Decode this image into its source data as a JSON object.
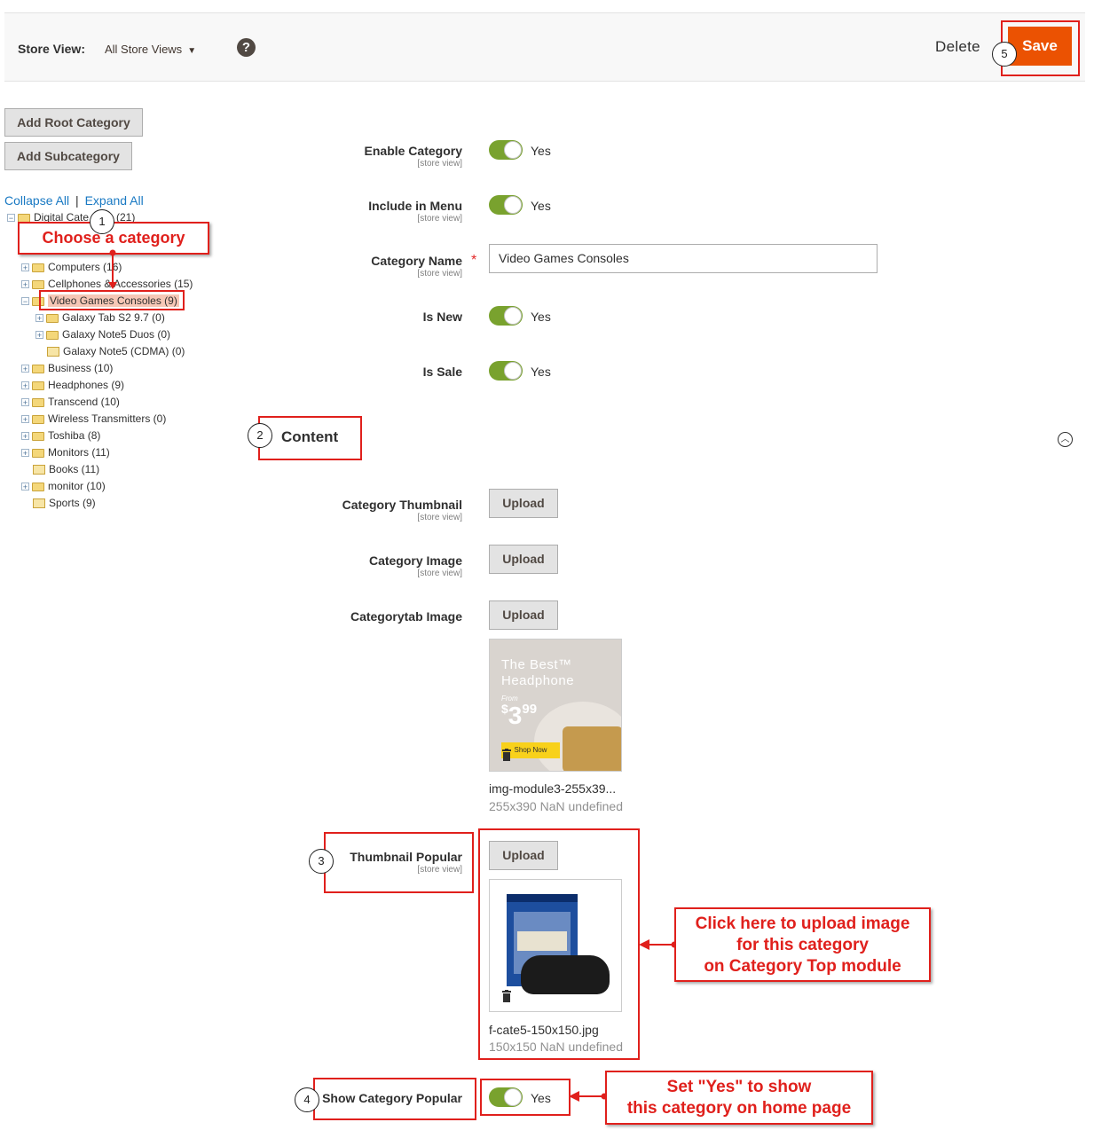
{
  "header": {
    "store_view_label": "Store View:",
    "store_view_value": "All Store Views",
    "help_glyph": "?",
    "delete_label": "Delete",
    "save_label": "Save"
  },
  "sidebar": {
    "add_root_label": "Add Root Category",
    "add_sub_label": "Add Subcategory",
    "collapse_all": "Collapse All",
    "separator": "|",
    "expand_all": "Expand All",
    "root": "Digital Cate",
    "root_count": "(21)",
    "tree": [
      {
        "label": "Computers (16)",
        "kind": "plus-folder"
      },
      {
        "label": "Cellphones & Accessories (15)",
        "kind": "plus-folder"
      },
      {
        "label": "Video Games Consoles (9)",
        "kind": "minus-folder"
      },
      {
        "label": "Galaxy Tab S2 9.7 (0)",
        "kind": "plus-folder"
      },
      {
        "label": "Galaxy Note5 Duos (0)",
        "kind": "plus-folder"
      },
      {
        "label": "Galaxy Note5 (CDMA) (0)",
        "kind": "leaf"
      },
      {
        "label": "Business (10)",
        "kind": "plus-folder"
      },
      {
        "label": "Headphones (9)",
        "kind": "plus-folder"
      },
      {
        "label": "Transcend (10)",
        "kind": "plus-folder"
      },
      {
        "label": "Wireless Transmitters (0)",
        "kind": "plus-folder"
      },
      {
        "label": "Toshiba (8)",
        "kind": "plus-folder"
      },
      {
        "label": "Monitors (11)",
        "kind": "plus-folder"
      },
      {
        "label": "Books (11)",
        "kind": "leaf"
      },
      {
        "label": "monitor (10)",
        "kind": "plus-folder"
      },
      {
        "label": "Sports (9)",
        "kind": "leaf"
      }
    ]
  },
  "annotations": {
    "n1": "1",
    "n2": "2",
    "n3": "3",
    "n4": "4",
    "n5": "5",
    "choose_category": "Choose a category",
    "upload_callout_line1": "Click here to upload image",
    "upload_callout_line2": "for this category",
    "upload_callout_line3": "on Category Top module",
    "set_yes_line1": "Set \"Yes\" to show",
    "set_yes_line2": "this category on home page"
  },
  "form": {
    "scope_label": "[store view]",
    "enable_category": "Enable Category",
    "include_in_menu": "Include in Menu",
    "category_name": "Category Name",
    "category_name_value": "Video Games Consoles",
    "required_mark": "*",
    "is_new": "Is New",
    "is_sale": "Is Sale",
    "yes": "Yes"
  },
  "content": {
    "section_title": "Content",
    "category_thumbnail": "Category Thumbnail",
    "category_image": "Category Image",
    "categorytab_image": "Categorytab Image",
    "upload_label": "Upload",
    "tab_file_name": "img-module3-255x39...",
    "tab_file_meta": "255x390 NaN undefined",
    "promo_title_line1": "The Best™",
    "promo_title_line2": "Headphone",
    "promo_from": "From",
    "promo_price_dollar": "$",
    "promo_price_main": "3",
    "promo_price_cents": "99",
    "promo_shop": "Shop Now",
    "thumbnail_popular": "Thumbnail Popular",
    "popular_file_name": "f-cate5-150x150.jpg",
    "popular_file_meta": "150x150 NaN undefined",
    "show_category_popular": "Show Category Popular"
  },
  "colors": {
    "accent": "#eb5202",
    "toggle_on": "#79a22e",
    "annotation_red": "#e0201c",
    "link": "#1979c3"
  }
}
